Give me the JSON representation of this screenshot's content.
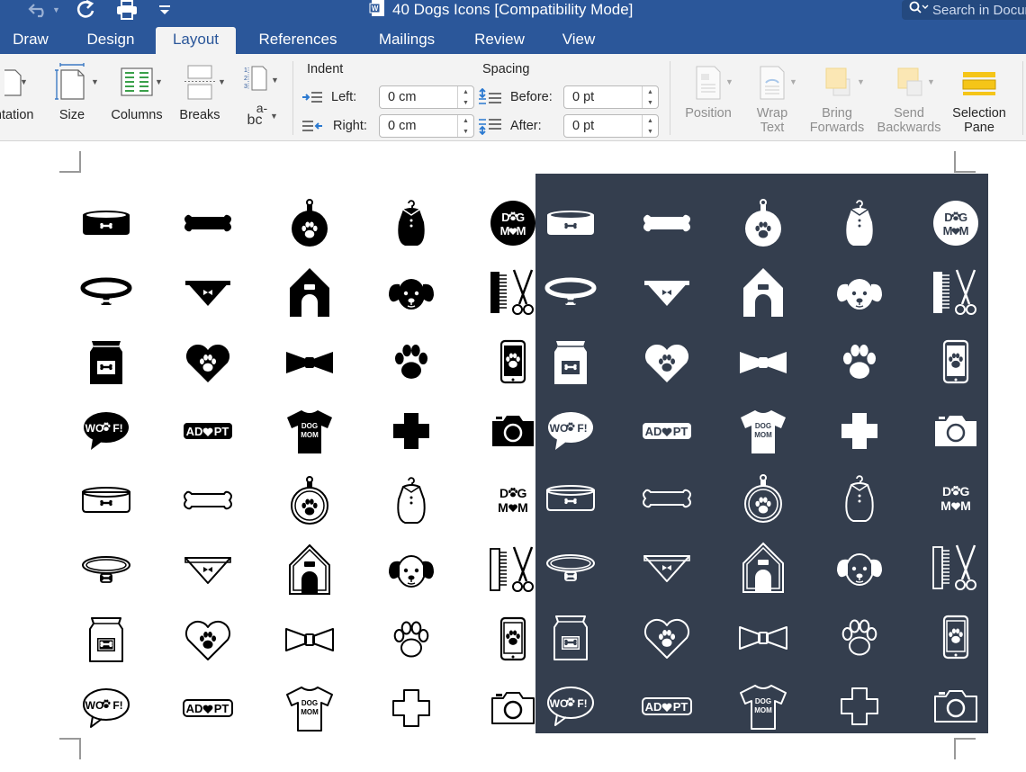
{
  "titlebar": {
    "doc_title": "40 Dogs Icons [Compatibility Mode]",
    "search_placeholder": "Search in Document"
  },
  "tabs": [
    {
      "label": "Draw"
    },
    {
      "label": "Design"
    },
    {
      "label": "Layout",
      "active": true
    },
    {
      "label": "References"
    },
    {
      "label": "Mailings"
    },
    {
      "label": "Review"
    },
    {
      "label": "View"
    }
  ],
  "ribbon": {
    "orientation": "Orientation",
    "size": "Size",
    "columns": "Columns",
    "breaks": "Breaks",
    "hyphenation_glyph_top": "a-",
    "hyphenation_glyph_bottom": "bc",
    "indent": {
      "title": "Indent",
      "left_label": "Left:",
      "left_value": "0 cm",
      "right_label": "Right:",
      "right_value": "0 cm"
    },
    "spacing": {
      "title": "Spacing",
      "before_label": "Before:",
      "before_value": "0 pt",
      "after_label": "After:",
      "after_value": "0 pt"
    },
    "arrange": {
      "position": "Position",
      "wrap_text_1": "Wrap",
      "wrap_text_2": "Text",
      "bring_forwards_1": "Bring",
      "bring_forwards_2": "Forwards",
      "send_backwards_1": "Send",
      "send_backwards_2": "Backwards",
      "selection_pane_1": "Selection",
      "selection_pane_2": "Pane"
    }
  },
  "colors": {
    "brand_blue": "#2b579a",
    "ribbon_bg": "#f3f3f3",
    "dark_panel": "#343e4e"
  },
  "icon_sets": [
    {
      "style": "solid",
      "color": "black",
      "rows": [
        [
          "bowl-icon",
          "bone-icon",
          "tag-icon",
          "coat-icon",
          "dog-mom-badge-icon"
        ],
        [
          "collar-icon",
          "bandana-icon",
          "doghouse-icon",
          "dog-face-icon",
          "grooming-icon"
        ],
        [
          "food-bag-icon",
          "heart-paw-icon",
          "bowtie-icon",
          "paw-icon",
          "phone-paw-icon"
        ],
        [
          "woof-bubble-icon",
          "adopt-badge-icon",
          "tshirt-icon",
          "cross-icon",
          "camera-icon"
        ]
      ]
    },
    {
      "style": "outline",
      "color": "black",
      "rows": [
        [
          "bowl-icon",
          "bone-icon",
          "tag-icon",
          "coat-icon",
          "dog-mom-text-icon"
        ],
        [
          "collar-icon",
          "bandana-icon",
          "doghouse-icon",
          "dog-face-icon",
          "grooming-icon"
        ],
        [
          "food-bag-icon",
          "heart-paw-icon",
          "bowtie-icon",
          "paw-icon",
          "phone-paw-icon"
        ],
        [
          "woof-bubble-icon",
          "adopt-badge-icon",
          "tshirt-icon",
          "cross-icon",
          "camera-icon"
        ]
      ]
    },
    {
      "style": "solid",
      "color": "white",
      "rows": [
        [
          "bowl-icon",
          "bone-icon",
          "tag-icon",
          "coat-icon",
          "dog-mom-badge-icon"
        ],
        [
          "collar-icon",
          "bandana-icon",
          "doghouse-icon",
          "dog-face-icon",
          "grooming-icon"
        ],
        [
          "food-bag-icon",
          "heart-paw-icon",
          "bowtie-icon",
          "paw-icon",
          "phone-paw-icon"
        ],
        [
          "woof-bubble-icon",
          "adopt-badge-icon",
          "tshirt-icon",
          "cross-icon",
          "camera-icon"
        ]
      ]
    },
    {
      "style": "outline",
      "color": "white",
      "rows": [
        [
          "bowl-icon",
          "bone-icon",
          "tag-icon",
          "coat-icon",
          "dog-mom-text-icon"
        ],
        [
          "collar-icon",
          "bandana-icon",
          "doghouse-icon",
          "dog-face-icon",
          "grooming-icon"
        ],
        [
          "food-bag-icon",
          "heart-paw-icon",
          "bowtie-icon",
          "paw-icon",
          "phone-paw-icon"
        ],
        [
          "woof-bubble-icon",
          "adopt-badge-icon",
          "tshirt-icon",
          "cross-icon",
          "camera-icon"
        ]
      ]
    }
  ],
  "icon_text": {
    "dog": "DOG",
    "mom": "MOM",
    "dog_mom_top": "D",
    "dog_mom_top_end": "G",
    "dog_mom_bottom": "M",
    "dog_mom_bottom_end": "M",
    "woof": "WO",
    "woof_end": "F!",
    "adopt": "AD",
    "adopt_end": "PT"
  }
}
